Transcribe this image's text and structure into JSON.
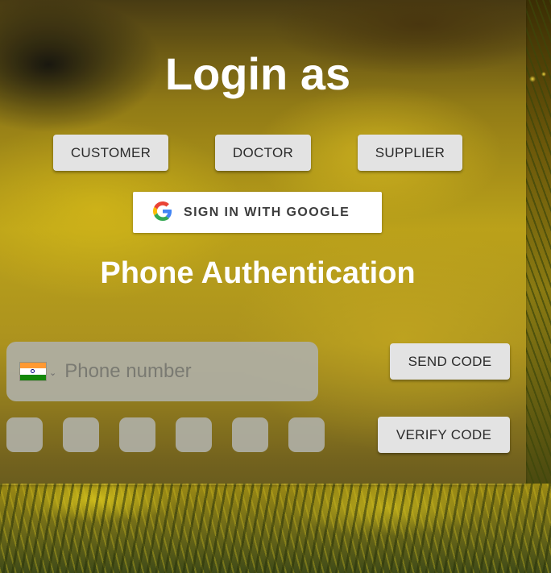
{
  "login": {
    "title": "Login as",
    "roles": [
      "CUSTOMER",
      "DOCTOR",
      "SUPPLIER"
    ],
    "google_label": "SIGN IN WITH GOOGLE"
  },
  "phone_auth": {
    "title": "Phone Authentication",
    "country": "India",
    "flag_icon": "india-flag-icon",
    "phone_placeholder": "Phone number",
    "phone_value": "",
    "send_code_label": "SEND CODE",
    "verify_code_label": "VERIFY CODE",
    "otp_digits": [
      "",
      "",
      "",
      "",
      "",
      ""
    ]
  },
  "colors": {
    "button_bg": "#e3e3e3",
    "title_text": "#ffffff",
    "input_bg": "#afafa5"
  }
}
